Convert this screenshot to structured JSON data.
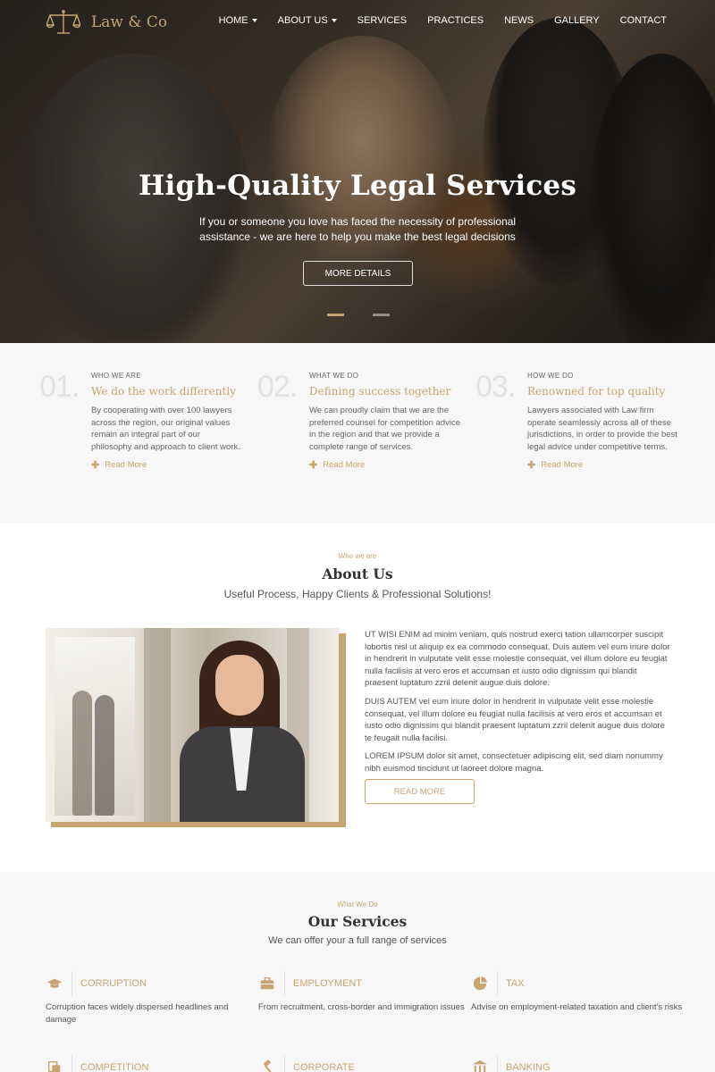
{
  "brand": {
    "name": "Law & Co",
    "accent": "#c8a473"
  },
  "nav": {
    "items": [
      {
        "label": "HOME",
        "has_dropdown": true
      },
      {
        "label": "ABOUT US",
        "has_dropdown": true
      },
      {
        "label": "SERVICES",
        "has_dropdown": false
      },
      {
        "label": "PRACTICES",
        "has_dropdown": false
      },
      {
        "label": "NEWS",
        "has_dropdown": false
      },
      {
        "label": "GALLERY",
        "has_dropdown": false
      },
      {
        "label": "CONTACT",
        "has_dropdown": false
      }
    ]
  },
  "hero": {
    "title": "High-Quality Legal Services",
    "subtitle": "If you or someone you love has faced the necessity of professional assistance - we are here to help you make the best legal decisions",
    "button": "MORE DETAILS",
    "slides": 2,
    "active_slide": 1
  },
  "features": [
    {
      "num": "01.",
      "kicker": "WHO WE ARE",
      "title": "We do the work differently",
      "text": "By cooperating with over 100 lawyers across the region, our original values remain an integral part of our philosophy and approach to client work.",
      "more": "Read More"
    },
    {
      "num": "02.",
      "kicker": "WHAT WE DO",
      "title": "Defining success together",
      "text": "We can proudly claim that we are the preferred counsel for competition advice in the region and that we provide a complete range of services.",
      "more": "Read More"
    },
    {
      "num": "03.",
      "kicker": "HOW WE DO",
      "title": "Renowned for top quality",
      "text": "Lawyers associated with Law firm operate seamlessly across all of these jurisdictions, in order to provide the best legal advice under competitive terms.",
      "more": "Read More"
    }
  ],
  "about": {
    "kicker": "Who we are",
    "title": "About Us",
    "subtitle": "Useful Process, Happy Clients & Professional Solutions!",
    "paragraphs": [
      "UT WISI ENIM ad minim veniam, quis nostrud exerci tation ullamcorper suscipit lobortis nisl ut aliquip ex ea commodo consequat. Duis autem vel eum iriure dolor in hendrerit in vulputate velit esse molestie consequat, vel illum dolore eu feugiat nulla facilisis at vero eros et accumsan et iusto odio dignissim qui blandit praesent luptatum zzril delenit augue duis dolore.",
      "DUIS AUTEM vel eum iriure dolor in hendrerit in vulputate velit esse molestie consequat, vel illum dolore eu feugiat nulla facilisis at vero eros et accumsan et iusto odio dignissim qui blandit praesent luptatum zzril delenit augue duis dolore te feugait nulla facilisi.",
      "LOREM IPSUM dolor sit amet, consectetuer adipiscing elit, sed diam nonummy nibh euismod tincidunt ut laoreet dolore magna."
    ],
    "button": "READ MORE"
  },
  "services": {
    "kicker": "What We Do",
    "title": "Our Services",
    "subtitle": "We can offer your a full range of services",
    "items": [
      {
        "icon": "graduation-cap-icon",
        "title": "CORRUPTION",
        "text": "Corruption faces widely dispersed headlines and damage"
      },
      {
        "icon": "briefcase-icon",
        "title": "EMPLOYMENT",
        "text": "From recruitment, cross-border and immigration issues"
      },
      {
        "icon": "pie-chart-icon",
        "title": "TAX",
        "text": "Advise on employment-related taxation and client's risks"
      },
      {
        "icon": "copy-icon",
        "title": "COMPETITION",
        "text": ""
      },
      {
        "icon": "gavel-icon",
        "title": "CORPORATE",
        "text": ""
      },
      {
        "icon": "bank-icon",
        "title": "BANKING",
        "text": ""
      }
    ]
  }
}
